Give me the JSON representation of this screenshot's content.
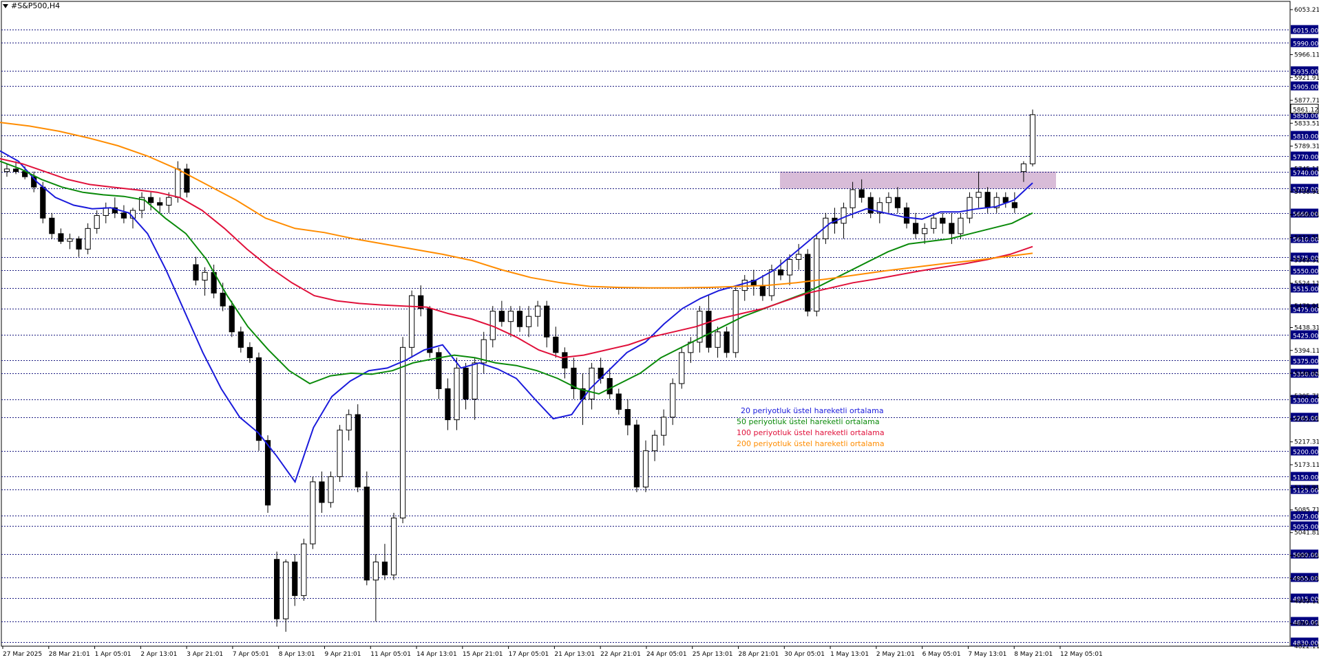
{
  "window": {
    "symbol_title": "#S&P500,H4"
  },
  "chart_data": {
    "type": "candlestick",
    "title": "#S&P500,H4",
    "ylim": [
      4822.11,
      6053.21
    ],
    "y_scale_labels": [
      "6053.21",
      "5966.11",
      "5921.91",
      "5877.71",
      "5833.51",
      "5789.31",
      "5745.11",
      "5700.91",
      "5656.71",
      "5612.51",
      "5568.31",
      "5524.11",
      "5479.91",
      "5438.31",
      "5394.11",
      "5349.91",
      "5305.71",
      "5261.51",
      "5217.31",
      "5173.11",
      "5128.91",
      "5085.71",
      "5041.81",
      "4997.51",
      "4953.31",
      "4909.11",
      "4865.91",
      "4822.11"
    ],
    "horizontal_levels": [
      {
        "value": 6015.0,
        "label": "6015.00"
      },
      {
        "value": 5990.0,
        "label": "5990.00"
      },
      {
        "value": 5935.0,
        "label": "5935.00"
      },
      {
        "value": 5905.0,
        "label": "5905.00"
      },
      {
        "value": 5850.0,
        "label": "5850.00"
      },
      {
        "value": 5810.0,
        "label": "5810.00"
      },
      {
        "value": 5770.0,
        "label": "5770.00"
      },
      {
        "value": 5740.0,
        "label": "5740.00"
      },
      {
        "value": 5707.0,
        "label": "5707.00"
      },
      {
        "value": 5660.0,
        "label": "5660.00"
      },
      {
        "value": 5610.0,
        "label": "5610.00"
      },
      {
        "value": 5575.0,
        "label": "5575.00"
      },
      {
        "value": 5550.0,
        "label": "5550.00"
      },
      {
        "value": 5515.0,
        "label": "5515.00"
      },
      {
        "value": 5475.0,
        "label": "5475.00"
      },
      {
        "value": 5425.0,
        "label": "5425.00"
      },
      {
        "value": 5375.0,
        "label": "5375.00"
      },
      {
        "value": 5350.0,
        "label": "5350.00"
      },
      {
        "value": 5300.0,
        "label": "5300.00"
      },
      {
        "value": 5265.0,
        "label": "5265.00"
      },
      {
        "value": 5200.0,
        "label": "5200.00"
      },
      {
        "value": 5150.0,
        "label": "5150.00"
      },
      {
        "value": 5125.0,
        "label": "5125.00"
      },
      {
        "value": 5075.0,
        "label": "5075.00"
      },
      {
        "value": 5055.0,
        "label": "5055.00"
      },
      {
        "value": 5000.0,
        "label": "5000.00"
      },
      {
        "value": 4955.0,
        "label": "4955.00"
      },
      {
        "value": 4915.0,
        "label": "4915.00"
      },
      {
        "value": 4870.0,
        "label": "4870.00"
      },
      {
        "value": 4830.0,
        "label": "4830.00"
      }
    ],
    "current_price_label": "5861.12",
    "x_labels": [
      "27 Mar 2025",
      "28 Mar 21:01",
      "1 Apr 05:01",
      "2 Apr 13:01",
      "3 Apr 21:01",
      "7 Apr 05:01",
      "8 Apr 13:01",
      "9 Apr 21:01",
      "11 Apr 05:01",
      "14 Apr 13:01",
      "15 Apr 21:01",
      "17 Apr 05:01",
      "21 Apr 13:01",
      "22 Apr 21:01",
      "24 Apr 05:01",
      "25 Apr 13:01",
      "28 Apr 21:01",
      "30 Apr 05:01",
      "1 May 13:01",
      "2 May 21:01",
      "6 May 05:01",
      "7 May 13:01",
      "8 May 21:01",
      "12 May 05:01"
    ],
    "resistance_zone": {
      "from": 5707,
      "to": 5740
    },
    "legend": [
      {
        "text": "20 periyotluk üstel hareketli ortalama",
        "color": "#1a1adb"
      },
      {
        "text": "50 periyotluk üstel hareketli ortalama",
        "color": "#0a8a0a"
      },
      {
        "text": "100 periyotluk üstel hareketli ortalama",
        "color": "#e0103a"
      },
      {
        "text": "200 periyotluk üstel hareketli ortalama",
        "color": "#ff8c00"
      }
    ],
    "series": [
      {
        "name": "20 periyotluk üstel hareketli ortalama",
        "color": "#1a1adb",
        "values": [
          5780,
          5760,
          5720,
          5690,
          5675,
          5668,
          5670,
          5660,
          5620,
          5550,
          5470,
          5390,
          5320,
          5265,
          5235,
          5190,
          5140,
          5245,
          5305,
          5335,
          5355,
          5360,
          5375,
          5395,
          5405,
          5360,
          5370,
          5358,
          5340,
          5300,
          5262,
          5270,
          5320,
          5355,
          5390,
          5410,
          5445,
          5475,
          5495,
          5510,
          5520,
          5530,
          5550,
          5580,
          5610,
          5640,
          5655,
          5668,
          5660,
          5652,
          5648,
          5662,
          5662,
          5668,
          5672,
          5685,
          5718
        ]
      },
      {
        "name": "50 periyotluk üstel hareketli ortalama",
        "color": "#0a8a0a",
        "values": [
          5760,
          5745,
          5725,
          5710,
          5700,
          5695,
          5692,
          5685,
          5650,
          5620,
          5570,
          5500,
          5440,
          5395,
          5355,
          5330,
          5345,
          5350,
          5348,
          5355,
          5370,
          5378,
          5385,
          5380,
          5370,
          5365,
          5355,
          5340,
          5320,
          5310,
          5330,
          5350,
          5380,
          5400,
          5420,
          5440,
          5460,
          5475,
          5490,
          5505,
          5525,
          5545,
          5565,
          5585,
          5600,
          5605,
          5610,
          5620,
          5630,
          5640,
          5660
        ]
      },
      {
        "name": "100 periyotluk üstel hareketli ortalama",
        "color": "#e0103a",
        "values": [
          5765,
          5755,
          5740,
          5725,
          5715,
          5710,
          5705,
          5700,
          5690,
          5665,
          5630,
          5590,
          5555,
          5525,
          5500,
          5490,
          5485,
          5482,
          5480,
          5478,
          5465,
          5455,
          5440,
          5420,
          5395,
          5380,
          5385,
          5395,
          5405,
          5420,
          5430,
          5440,
          5455,
          5465,
          5475,
          5490,
          5505,
          5515,
          5525,
          5532,
          5540,
          5548,
          5555,
          5562,
          5570,
          5580,
          5595
        ]
      },
      {
        "name": "200 periyotluk üstel hareketli ortalama",
        "color": "#ff8c00",
        "values": [
          5835,
          5828,
          5818,
          5805,
          5790,
          5770,
          5745,
          5715,
          5685,
          5650,
          5630,
          5622,
          5610,
          5600,
          5590,
          5580,
          5568,
          5550,
          5535,
          5525,
          5518,
          5516,
          5515,
          5515,
          5516,
          5518,
          5520,
          5525,
          5532,
          5540,
          5548,
          5555,
          5562,
          5568,
          5575,
          5582
        ]
      }
    ],
    "candles": [
      [
        5740,
        5755,
        5730,
        5745
      ],
      [
        5745,
        5760,
        5735,
        5740
      ],
      [
        5740,
        5750,
        5725,
        5730
      ],
      [
        5730,
        5740,
        5700,
        5710
      ],
      [
        5710,
        5720,
        5640,
        5650
      ],
      [
        5650,
        5660,
        5610,
        5620
      ],
      [
        5620,
        5630,
        5600,
        5605
      ],
      [
        5605,
        5620,
        5590,
        5610
      ],
      [
        5610,
        5615,
        5575,
        5590
      ],
      [
        5590,
        5640,
        5580,
        5630
      ],
      [
        5630,
        5665,
        5620,
        5655
      ],
      [
        5655,
        5680,
        5640,
        5670
      ],
      [
        5670,
        5690,
        5650,
        5660
      ],
      [
        5660,
        5675,
        5640,
        5650
      ],
      [
        5650,
        5670,
        5630,
        5665
      ],
      [
        5665,
        5700,
        5650,
        5690
      ],
      [
        5690,
        5700,
        5665,
        5680
      ],
      [
        5680,
        5690,
        5660,
        5675
      ],
      [
        5675,
        5700,
        5660,
        5690
      ],
      [
        5690,
        5760,
        5680,
        5745
      ],
      [
        5745,
        5755,
        5690,
        5700
      ],
      [
        5560,
        5575,
        5520,
        5530
      ],
      [
        5530,
        5555,
        5500,
        5545
      ],
      [
        5545,
        5560,
        5495,
        5505
      ],
      [
        5505,
        5525,
        5470,
        5480
      ],
      [
        5480,
        5490,
        5420,
        5430
      ],
      [
        5430,
        5440,
        5390,
        5400
      ],
      [
        5400,
        5410,
        5370,
        5380
      ],
      [
        5380,
        5390,
        5200,
        5220
      ],
      [
        5220,
        5230,
        5080,
        5095
      ],
      [
        4990,
        5005,
        4860,
        4875
      ],
      [
        4875,
        4990,
        4850,
        4985
      ],
      [
        4985,
        5000,
        4900,
        4920
      ],
      [
        4920,
        5030,
        4910,
        5020
      ],
      [
        5020,
        5150,
        5010,
        5140
      ],
      [
        5140,
        5160,
        5080,
        5100
      ],
      [
        5100,
        5160,
        5090,
        5150
      ],
      [
        5150,
        5250,
        5140,
        5240
      ],
      [
        5240,
        5280,
        5220,
        5270
      ],
      [
        5270,
        5290,
        5120,
        5130
      ],
      [
        5130,
        5160,
        4940,
        4950
      ],
      [
        4950,
        5000,
        4870,
        4985
      ],
      [
        4985,
        5020,
        4950,
        4960
      ],
      [
        4960,
        5080,
        4950,
        5070
      ],
      [
        5070,
        5420,
        5060,
        5400
      ],
      [
        5400,
        5510,
        5380,
        5500
      ],
      [
        5500,
        5520,
        5460,
        5475
      ],
      [
        5475,
        5480,
        5380,
        5390
      ],
      [
        5390,
        5400,
        5300,
        5320
      ],
      [
        5320,
        5340,
        5240,
        5260
      ],
      [
        5260,
        5380,
        5240,
        5360
      ],
      [
        5360,
        5370,
        5280,
        5300
      ],
      [
        5300,
        5380,
        5260,
        5370
      ],
      [
        5370,
        5430,
        5350,
        5415
      ],
      [
        5415,
        5480,
        5400,
        5470
      ],
      [
        5470,
        5490,
        5440,
        5450
      ],
      [
        5450,
        5480,
        5420,
        5470
      ],
      [
        5470,
        5480,
        5430,
        5440
      ],
      [
        5440,
        5480,
        5420,
        5460
      ],
      [
        5460,
        5490,
        5440,
        5480
      ],
      [
        5480,
        5490,
        5400,
        5420
      ],
      [
        5420,
        5440,
        5380,
        5390
      ],
      [
        5390,
        5400,
        5340,
        5360
      ],
      [
        5360,
        5380,
        5300,
        5320
      ],
      [
        5320,
        5350,
        5250,
        5300
      ],
      [
        5300,
        5370,
        5280,
        5360
      ],
      [
        5360,
        5380,
        5330,
        5340
      ],
      [
        5340,
        5360,
        5300,
        5310
      ],
      [
        5310,
        5320,
        5270,
        5280
      ],
      [
        5280,
        5300,
        5230,
        5250
      ],
      [
        5250,
        5260,
        5120,
        5130
      ],
      [
        5130,
        5220,
        5120,
        5200
      ],
      [
        5200,
        5240,
        5180,
        5230
      ],
      [
        5230,
        5280,
        5210,
        5265
      ],
      [
        5265,
        5340,
        5250,
        5330
      ],
      [
        5330,
        5400,
        5320,
        5390
      ],
      [
        5390,
        5420,
        5370,
        5410
      ],
      [
        5410,
        5480,
        5390,
        5470
      ],
      [
        5470,
        5500,
        5390,
        5400
      ],
      [
        5400,
        5440,
        5380,
        5430
      ],
      [
        5430,
        5440,
        5380,
        5390
      ],
      [
        5390,
        5520,
        5380,
        5510
      ],
      [
        5510,
        5540,
        5490,
        5530
      ],
      [
        5530,
        5550,
        5500,
        5520
      ],
      [
        5520,
        5540,
        5490,
        5500
      ],
      [
        5500,
        5560,
        5490,
        5550
      ],
      [
        5550,
        5570,
        5530,
        5540
      ],
      [
        5540,
        5580,
        5520,
        5570
      ],
      [
        5570,
        5600,
        5550,
        5580
      ],
      [
        5580,
        5590,
        5460,
        5470
      ],
      [
        5470,
        5620,
        5460,
        5610
      ],
      [
        5610,
        5660,
        5600,
        5650
      ],
      [
        5650,
        5670,
        5620,
        5640
      ],
      [
        5640,
        5680,
        5610,
        5670
      ],
      [
        5670,
        5720,
        5650,
        5705
      ],
      [
        5705,
        5725,
        5680,
        5690
      ],
      [
        5690,
        5700,
        5650,
        5660
      ],
      [
        5660,
        5690,
        5640,
        5680
      ],
      [
        5680,
        5700,
        5660,
        5690
      ],
      [
        5690,
        5710,
        5660,
        5670
      ],
      [
        5670,
        5680,
        5630,
        5640
      ],
      [
        5640,
        5660,
        5610,
        5620
      ],
      [
        5620,
        5640,
        5600,
        5630
      ],
      [
        5630,
        5660,
        5620,
        5650
      ],
      [
        5650,
        5660,
        5620,
        5640
      ],
      [
        5640,
        5660,
        5600,
        5620
      ],
      [
        5620,
        5660,
        5610,
        5650
      ],
      [
        5650,
        5700,
        5640,
        5690
      ],
      [
        5690,
        5740,
        5670,
        5700
      ],
      [
        5700,
        5710,
        5660,
        5670
      ],
      [
        5670,
        5700,
        5660,
        5690
      ],
      [
        5690,
        5700,
        5670,
        5680
      ],
      [
        5680,
        5700,
        5660,
        5670
      ],
      [
        5740,
        5760,
        5720,
        5755
      ],
      [
        5755,
        5860,
        5750,
        5850
      ]
    ]
  }
}
